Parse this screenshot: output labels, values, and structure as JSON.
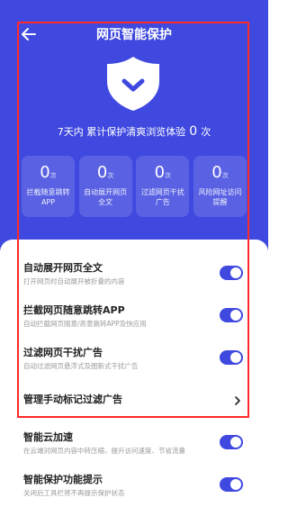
{
  "header": {
    "title": "网页智能保护",
    "back_icon": "arrow-left-icon"
  },
  "hero": {
    "shield_icon": "shield-check-icon",
    "summary_prefix": "7天内 累计保护清爽浏览体验",
    "summary_count": "0",
    "summary_unit": "次"
  },
  "stats": [
    {
      "value": "0",
      "unit": "次",
      "label": "拦截随意跳转APP"
    },
    {
      "value": "0",
      "unit": "次",
      "label": "自动展开网页全文"
    },
    {
      "value": "0",
      "unit": "次",
      "label": "过滤网页干扰广告"
    },
    {
      "value": "0",
      "unit": "次",
      "label": "风险网址访问提醒"
    }
  ],
  "settings": [
    {
      "title": "自动展开网页全文",
      "subtitle": "打开网页时自动展开被折叠的内容",
      "enabled": true
    },
    {
      "title": "拦截网页随意跳转APP",
      "subtitle": "自动拦截网页随意/恶意跳转APP及快应用",
      "enabled": true
    },
    {
      "title": "过滤网页干扰广告",
      "subtitle": "自动过滤网页悬浮式及图新式干扰广告",
      "enabled": true
    },
    {
      "title": "管理手动标记过滤广告",
      "chevron_icon": "chevron-right-icon"
    },
    {
      "title": "智能云加速",
      "subtitle": "在云端对网页内容中转压缩，提升访问速度、节省流量",
      "enabled": true
    },
    {
      "title": "智能保护功能提示",
      "subtitle": "关闭后工具栏将不再提示保护状态",
      "enabled": true
    }
  ],
  "colors": {
    "primary": "#3f49df",
    "highlight": "#ff2a2a"
  }
}
